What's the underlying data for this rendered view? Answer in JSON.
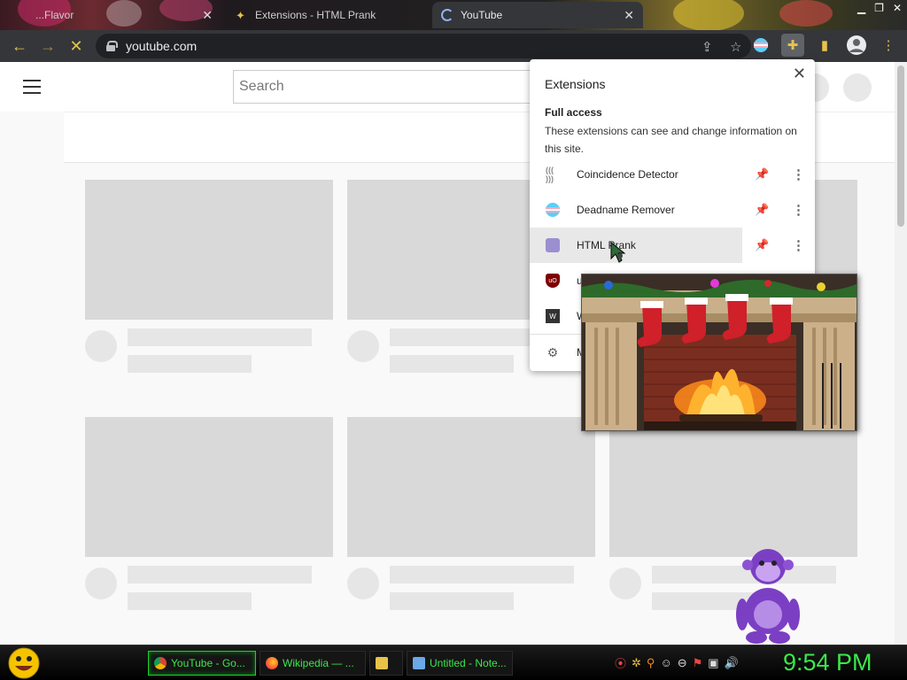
{
  "browser": {
    "tabs": [
      {
        "label": "...Flavor",
        "active": false
      },
      {
        "label": "Extensions - HTML Prank",
        "active": false
      },
      {
        "label": "YouTube",
        "active": true
      }
    ],
    "url": "youtube.com"
  },
  "youtube": {
    "search_placeholder": "Search"
  },
  "extensions_popup": {
    "title": "Extensions",
    "section_title": "Full access",
    "section_desc": "These extensions can see and change information on this site.",
    "items": [
      {
        "name": "Coincidence Detector",
        "icon": "coincidence-icon",
        "pinned": false
      },
      {
        "name": "Deadname Remover",
        "icon": "trans-flag-icon",
        "pinned": true
      },
      {
        "name": "HTML Prank",
        "icon": "prank-icon",
        "pinned": false
      },
      {
        "name": "u",
        "icon": "ublock-icon",
        "pinned": false
      },
      {
        "name": "W",
        "icon": "wiki-icon",
        "pinned": false
      },
      {
        "name": "M",
        "icon": "gear-icon",
        "pinned": false
      }
    ]
  },
  "taskbar": {
    "tasks": [
      {
        "label": "YouTube - Go...",
        "icon": "chrome-icon",
        "active": true
      },
      {
        "label": "Wikipedia — ...",
        "icon": "firefox-icon",
        "active": false
      },
      {
        "label": "",
        "icon": "folder-icon",
        "active": false
      },
      {
        "label": "Untitled - Note...",
        "icon": "notepad-icon",
        "active": false
      }
    ],
    "clock": "9:54 PM"
  },
  "colors": {
    "taskbar_text": "#3ae84a",
    "toolbar_icons": "#e8c34a",
    "pin_active": "#1a73e8"
  }
}
